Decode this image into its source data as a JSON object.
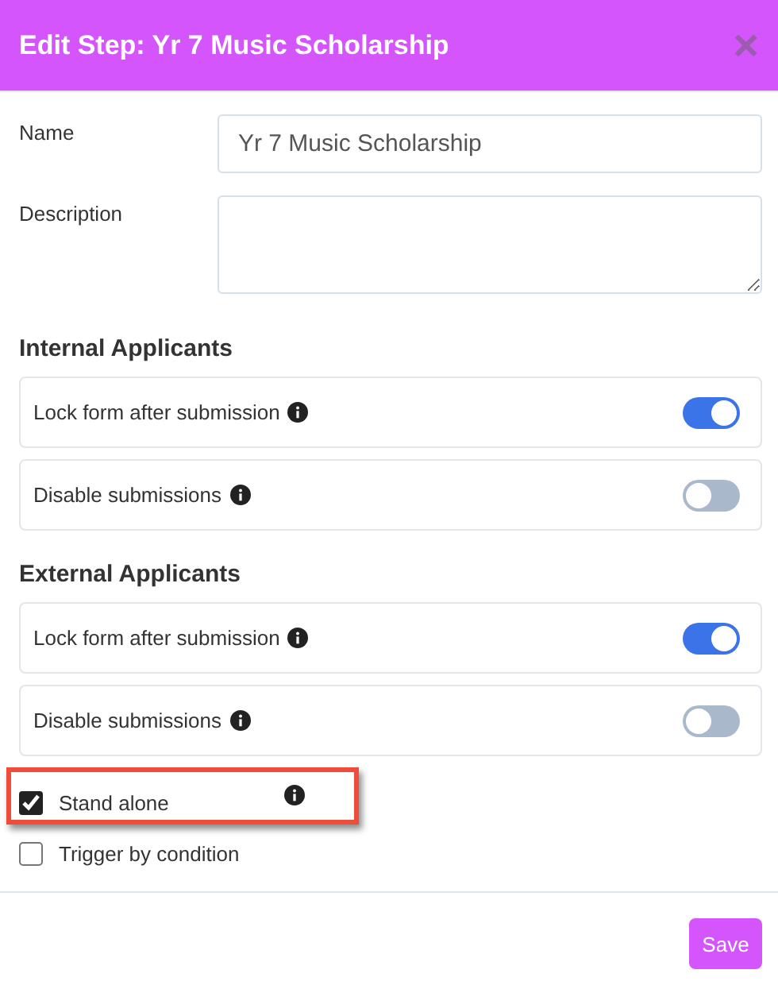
{
  "dialog": {
    "title": "Edit Step: Yr 7 Music Scholarship",
    "close_icon": "×"
  },
  "fields": [
    {
      "kind": "input",
      "label": "Name",
      "value": "Yr 7 Music Scholarship"
    },
    {
      "kind": "textarea",
      "label": "Description"
    }
  ],
  "sections": [
    {
      "title": "Internal Applicants",
      "toggles": [
        {
          "label": "Lock form after submission",
          "on": true
        },
        {
          "label": "Disable submissions",
          "on": false
        }
      ]
    },
    {
      "title": "External Applicants",
      "toggles": [
        {
          "label": "Lock form after submission",
          "on": true
        },
        {
          "label": "Disable submissions",
          "on": false
        }
      ]
    }
  ],
  "checkboxes": [
    {
      "label": "Stand alone",
      "checked": true,
      "info": true,
      "highlighted": true
    },
    {
      "label": "Trigger by condition",
      "checked": false,
      "info": false,
      "highlighted": false
    }
  ],
  "buttons": [
    {
      "label": "Save"
    }
  ]
}
